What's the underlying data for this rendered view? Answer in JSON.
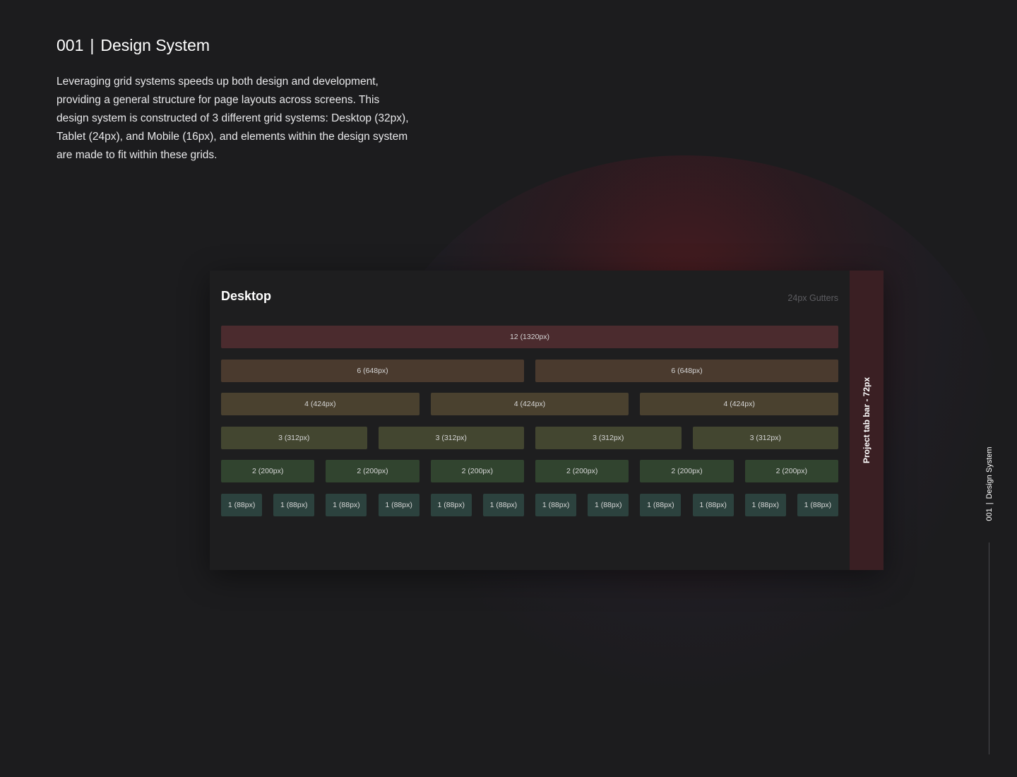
{
  "header": {
    "number": "001",
    "separator": "|",
    "title": "Design System",
    "description": "Leveraging grid systems speeds up both design and development, providing a general structure for page layouts across screens. This design system is constructed of 3 different grid systems: Desktop (32px), Tablet (24px), and Mobile (16px), and elements within the design system are made to fit within these grids."
  },
  "panel": {
    "title": "Desktop",
    "gutter_note": "24px Gutters",
    "tab_bar_label": "Project tab bar - 72px"
  },
  "grid_rows": [
    {
      "span": 12,
      "label": "12 (1320px)",
      "count": 1,
      "color": "#4b2b2e"
    },
    {
      "span": 6,
      "label": "6 (648px)",
      "count": 2,
      "color": "#4a3a2e"
    },
    {
      "span": 4,
      "label": "4 (424px)",
      "count": 3,
      "color": "#4a412f"
    },
    {
      "span": 3,
      "label": "3 (312px)",
      "count": 4,
      "color": "#434630"
    },
    {
      "span": 2,
      "label": "2 (200px)",
      "count": 6,
      "color": "#31442f"
    },
    {
      "span": 1,
      "label": "1 (88px)",
      "count": 12,
      "color": "#2c423e"
    }
  ],
  "side_label": {
    "number": "001",
    "separator": "|",
    "title": "Design System"
  }
}
